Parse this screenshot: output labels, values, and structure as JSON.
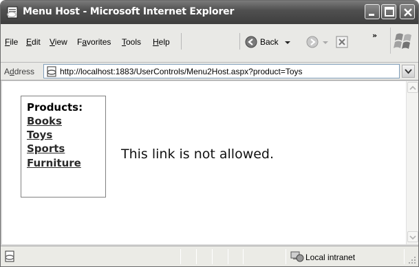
{
  "window": {
    "title": "Menu Host - Microsoft Internet Explorer"
  },
  "menu": {
    "items": [
      {
        "label": "File",
        "mnemonic": "F",
        "rest": "ile"
      },
      {
        "label": "Edit",
        "mnemonic": "E",
        "rest": "dit"
      },
      {
        "label": "View",
        "mnemonic": "V",
        "rest": "iew"
      },
      {
        "label": "Favorites",
        "pre": "F",
        "mnemonic": "a",
        "rest": "vorites"
      },
      {
        "label": "Tools",
        "mnemonic": "T",
        "rest": "ools"
      },
      {
        "label": "Help",
        "mnemonic": "H",
        "rest": "elp"
      }
    ]
  },
  "toolbar": {
    "back_label": "Back",
    "more_chevron": "»"
  },
  "address": {
    "label_pre": "A",
    "label_mnemonic": "d",
    "label_rest": "dress",
    "url": "http://localhost:1883/UserControls/Menu2Host.aspx?product=Toys"
  },
  "page": {
    "products_label": "Products:",
    "links": [
      "Books",
      "Toys",
      "Sports",
      "Furniture"
    ],
    "message": "This link is not allowed."
  },
  "status": {
    "zone": "Local intranet"
  },
  "icons": {
    "app": "ie-page-icon",
    "back": "back-arrow-icon",
    "forward": "forward-arrow-icon",
    "stop": "stop-icon",
    "logo": "windows-flag-icon",
    "status_page": "page-done-icon",
    "zone": "intranet-icon"
  }
}
